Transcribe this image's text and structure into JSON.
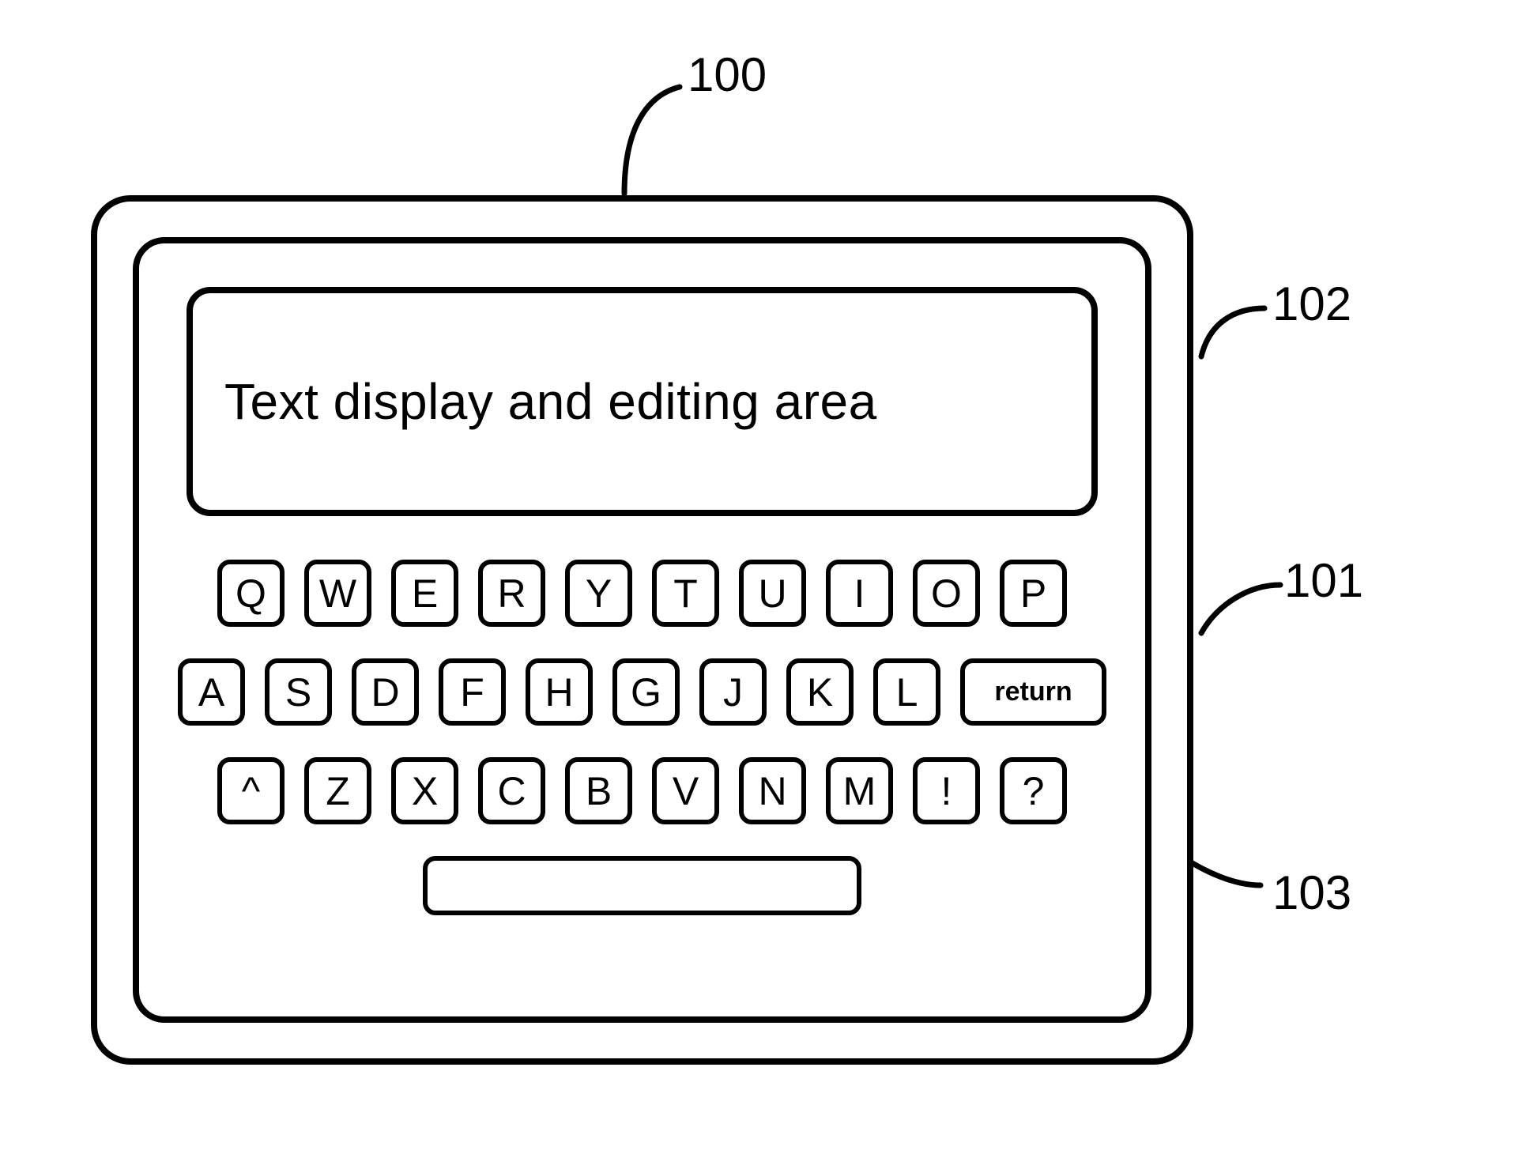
{
  "refs": {
    "device": "100",
    "screen": "101",
    "text_area": "102",
    "keyboard": "103"
  },
  "text_area_label": "Text display and editing area",
  "keyboard": {
    "row1": [
      "Q",
      "W",
      "E",
      "R",
      "Y",
      "T",
      "U",
      "I",
      "O",
      "P"
    ],
    "row2": [
      "A",
      "S",
      "D",
      "F",
      "H",
      "G",
      "J",
      "K",
      "L"
    ],
    "row2_return": "return",
    "row3": [
      "^",
      "Z",
      "X",
      "C",
      "B",
      "V",
      "N",
      "M",
      "!",
      "?"
    ],
    "space": ""
  }
}
